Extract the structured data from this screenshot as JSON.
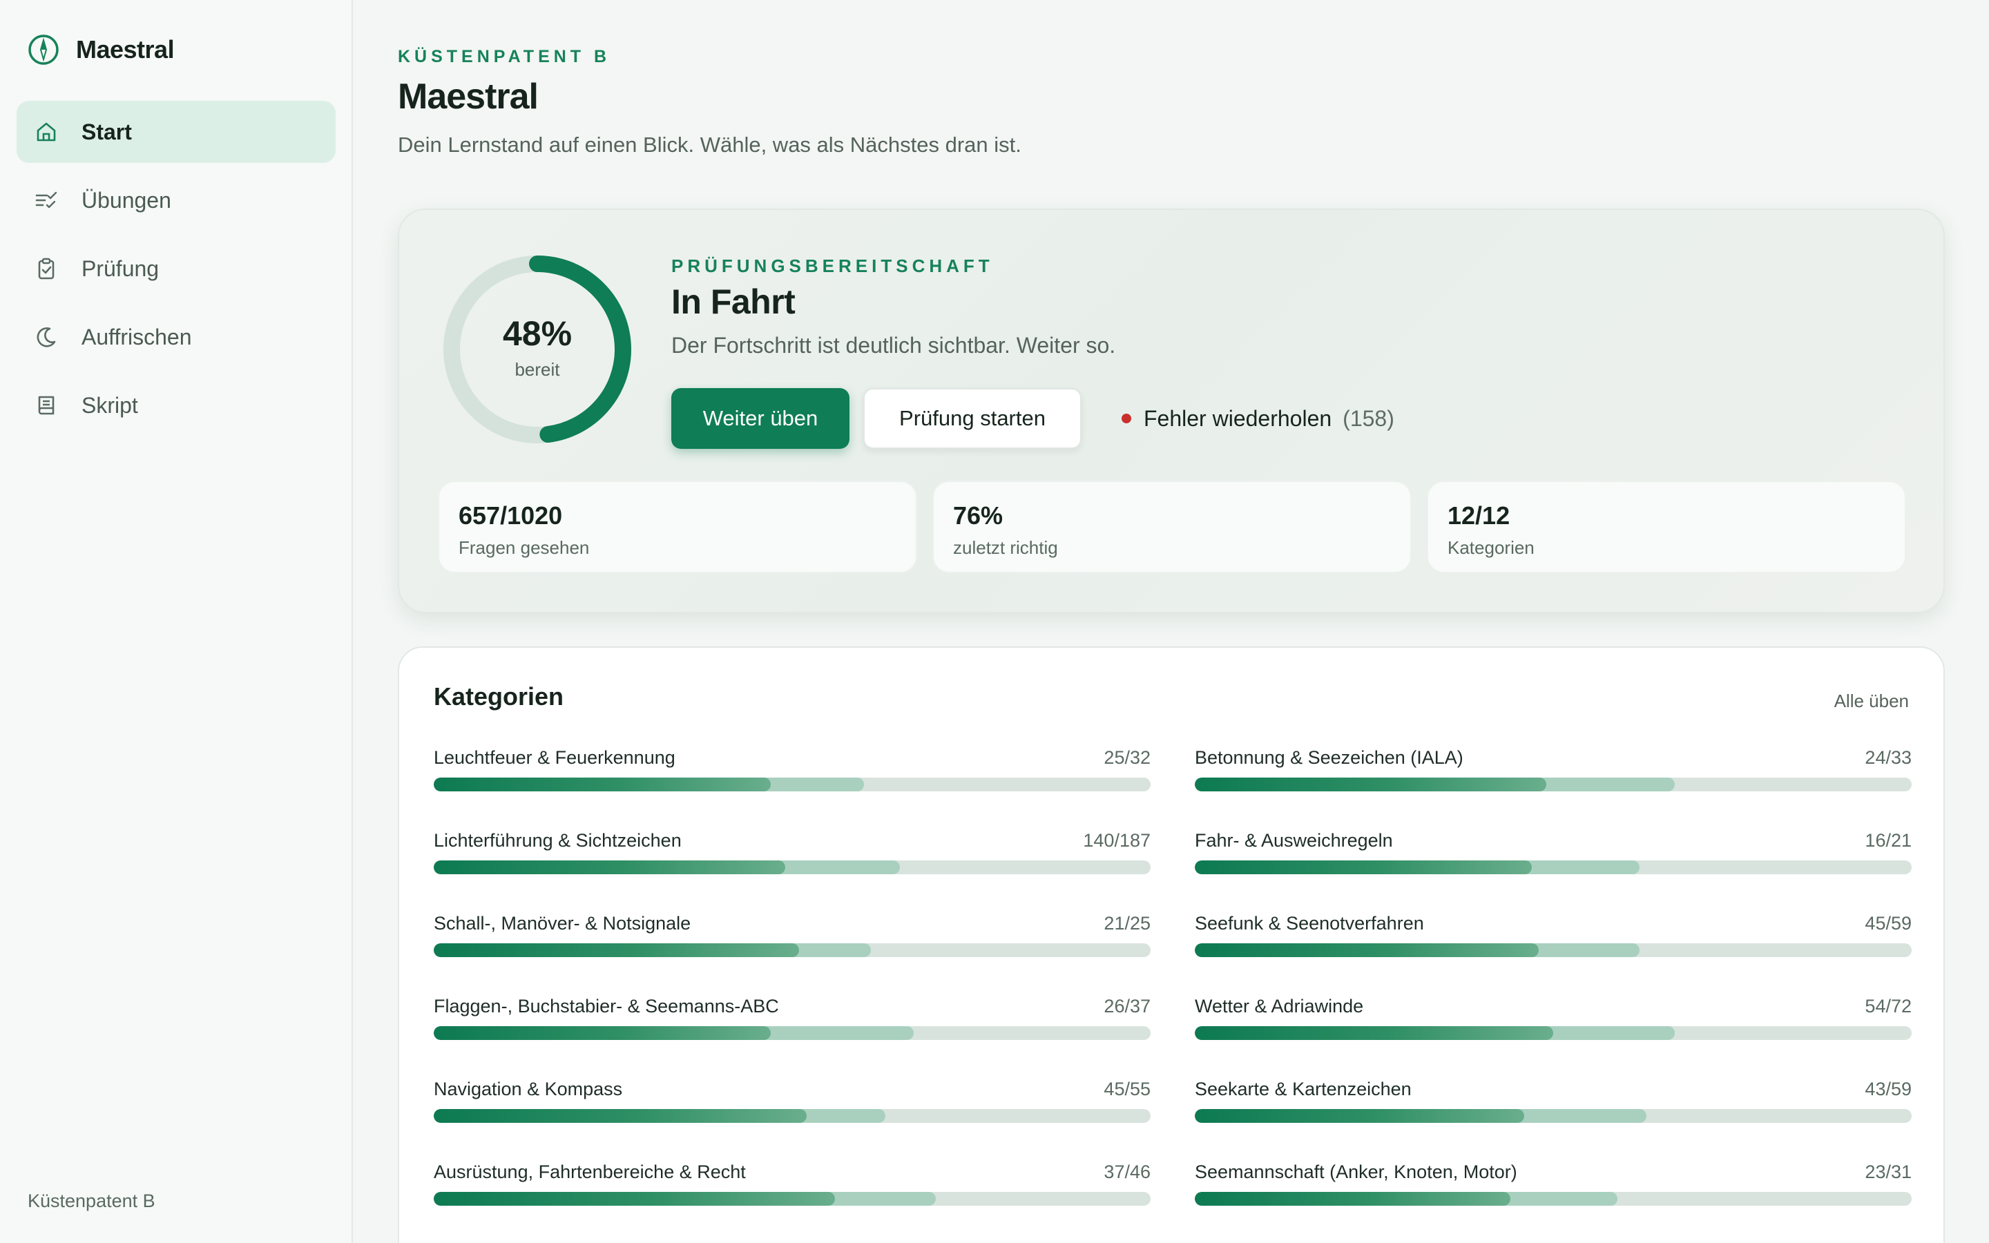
{
  "app": {
    "name": "Maestral",
    "footer": "Küstenpatent B"
  },
  "nav": [
    {
      "label": "Start",
      "icon": "home-icon",
      "active": true
    },
    {
      "label": "Übungen",
      "icon": "checklist-icon",
      "active": false
    },
    {
      "label": "Prüfung",
      "icon": "clipboard-check-icon",
      "active": false
    },
    {
      "label": "Auffrischen",
      "icon": "moon-icon",
      "active": false
    },
    {
      "label": "Skript",
      "icon": "book-icon",
      "active": false
    }
  ],
  "header": {
    "eyebrow": "KÜSTENPATENT B",
    "title": "Maestral",
    "subtitle": "Dein Lernstand auf einen Blick. Wähle, was als Nächstes dran ist."
  },
  "readiness": {
    "percent_value": 48,
    "percent_text": "48%",
    "percent_label": "bereit",
    "eyebrow": "PRÜFUNGSBEREITSCHAFT",
    "title": "In Fahrt",
    "text": "Der Fortschritt ist deutlich sichtbar. Weiter so.",
    "primary_button": "Weiter üben",
    "secondary_button": "Prüfung starten",
    "errors_label": "Fehler wiederholen",
    "errors_count": "(158)"
  },
  "stats": [
    {
      "value": "657/1020",
      "label": "Fragen gesehen"
    },
    {
      "value": "76%",
      "label": "zuletzt richtig"
    },
    {
      "value": "12/12",
      "label": "Kategorien"
    }
  ],
  "categories": {
    "title": "Kategorien",
    "action": "Alle üben",
    "left": [
      {
        "name": "Leuchtfeuer & Feuerkennung",
        "count": "25/32",
        "correct": 0.47,
        "seen": 0.6
      },
      {
        "name": "Lichterführung & Sichtzeichen",
        "count": "140/187",
        "correct": 0.49,
        "seen": 0.65
      },
      {
        "name": "Schall-, Manöver- & Notsignale",
        "count": "21/25",
        "correct": 0.51,
        "seen": 0.61
      },
      {
        "name": "Flaggen-, Buchstabier- & Seemanns-ABC",
        "count": "26/37",
        "correct": 0.47,
        "seen": 0.67
      },
      {
        "name": "Navigation & Kompass",
        "count": "45/55",
        "correct": 0.52,
        "seen": 0.63
      },
      {
        "name": "Ausrüstung, Fahrtenbereiche & Recht",
        "count": "37/46",
        "correct": 0.56,
        "seen": 0.7
      }
    ],
    "right": [
      {
        "name": "Betonnung & Seezeichen (IALA)",
        "count": "24/33",
        "correct": 0.49,
        "seen": 0.67
      },
      {
        "name": "Fahr- & Ausweichregeln",
        "count": "16/21",
        "correct": 0.47,
        "seen": 0.62
      },
      {
        "name": "Seefunk & Seenotverfahren",
        "count": "45/59",
        "correct": 0.48,
        "seen": 0.62
      },
      {
        "name": "Wetter & Adriawinde",
        "count": "54/72",
        "correct": 0.5,
        "seen": 0.67
      },
      {
        "name": "Seekarte & Kartenzeichen",
        "count": "43/59",
        "correct": 0.46,
        "seen": 0.63
      },
      {
        "name": "Seemannschaft (Anker, Knoten, Motor)",
        "count": "23/31",
        "correct": 0.44,
        "seen": 0.59
      }
    ]
  },
  "colors": {
    "accent": "#0f7d55",
    "danger": "#c9302c",
    "track": "#d9e3de"
  }
}
